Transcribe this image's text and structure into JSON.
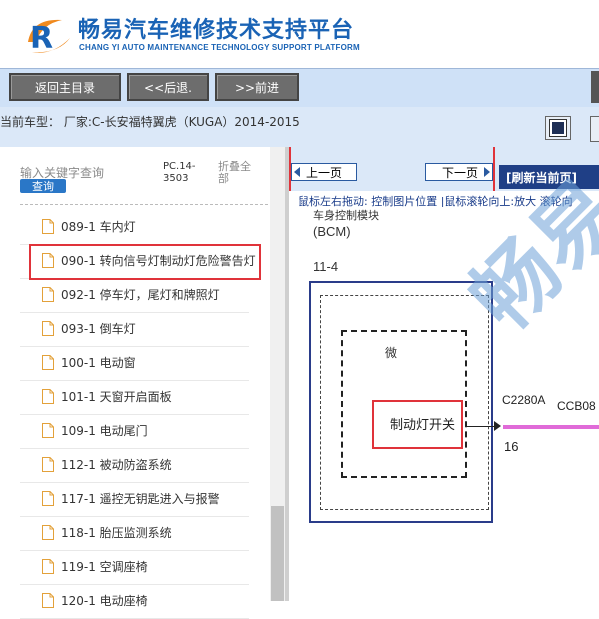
{
  "header": {
    "title": "畅易汽车维修技术支持平台",
    "subtitle": "CHANG YI AUTO MAINTENANCE TECHNOLOGY SUPPORT PLATFORM"
  },
  "nav": {
    "home": "返回主目录",
    "back": "<<后退.",
    "forward": ">>前进"
  },
  "car": {
    "text": "当前车型： 厂家:C-长安福特翼虎（KUGA）2014-2015"
  },
  "left_panel": {
    "search_placeholder": "输入关键字查询",
    "search_button": "查询",
    "pc_code": "PC.14-3503",
    "collapse_all": "折叠全部",
    "items": [
      {
        "label": "089-1 车内灯"
      },
      {
        "label": "090-1 转向信号灯制动灯危险警告灯"
      },
      {
        "label": "092-1 停车灯，尾灯和牌照灯"
      },
      {
        "label": "093-1 倒车灯"
      },
      {
        "label": "100-1 电动窗"
      },
      {
        "label": "101-1 天窗开启面板"
      },
      {
        "label": "109-1 电动尾门"
      },
      {
        "label": "112-1 被动防盗系统"
      },
      {
        "label": "117-1 遥控无钥匙进入与报警"
      },
      {
        "label": "118-1 胎压监测系统"
      },
      {
        "label": "119-1 空调座椅"
      },
      {
        "label": "120-1 电动座椅"
      }
    ]
  },
  "right_panel": {
    "prev": "上一页",
    "next": "下一页",
    "refresh": "[刷新当前页]",
    "tip": "鼠标左右拖动: 控制图片位置 |鼠标滚轮向上:放大  滚轮向",
    "diagram": {
      "top_label": "车身控制模块",
      "bcm": "(BCM)",
      "pin_group": "11-4",
      "wei": "微",
      "switch": "制动灯开关",
      "connector": "C2280A",
      "circuit": "CCB08",
      "pin": "16",
      "watermark": "畅易"
    }
  }
}
